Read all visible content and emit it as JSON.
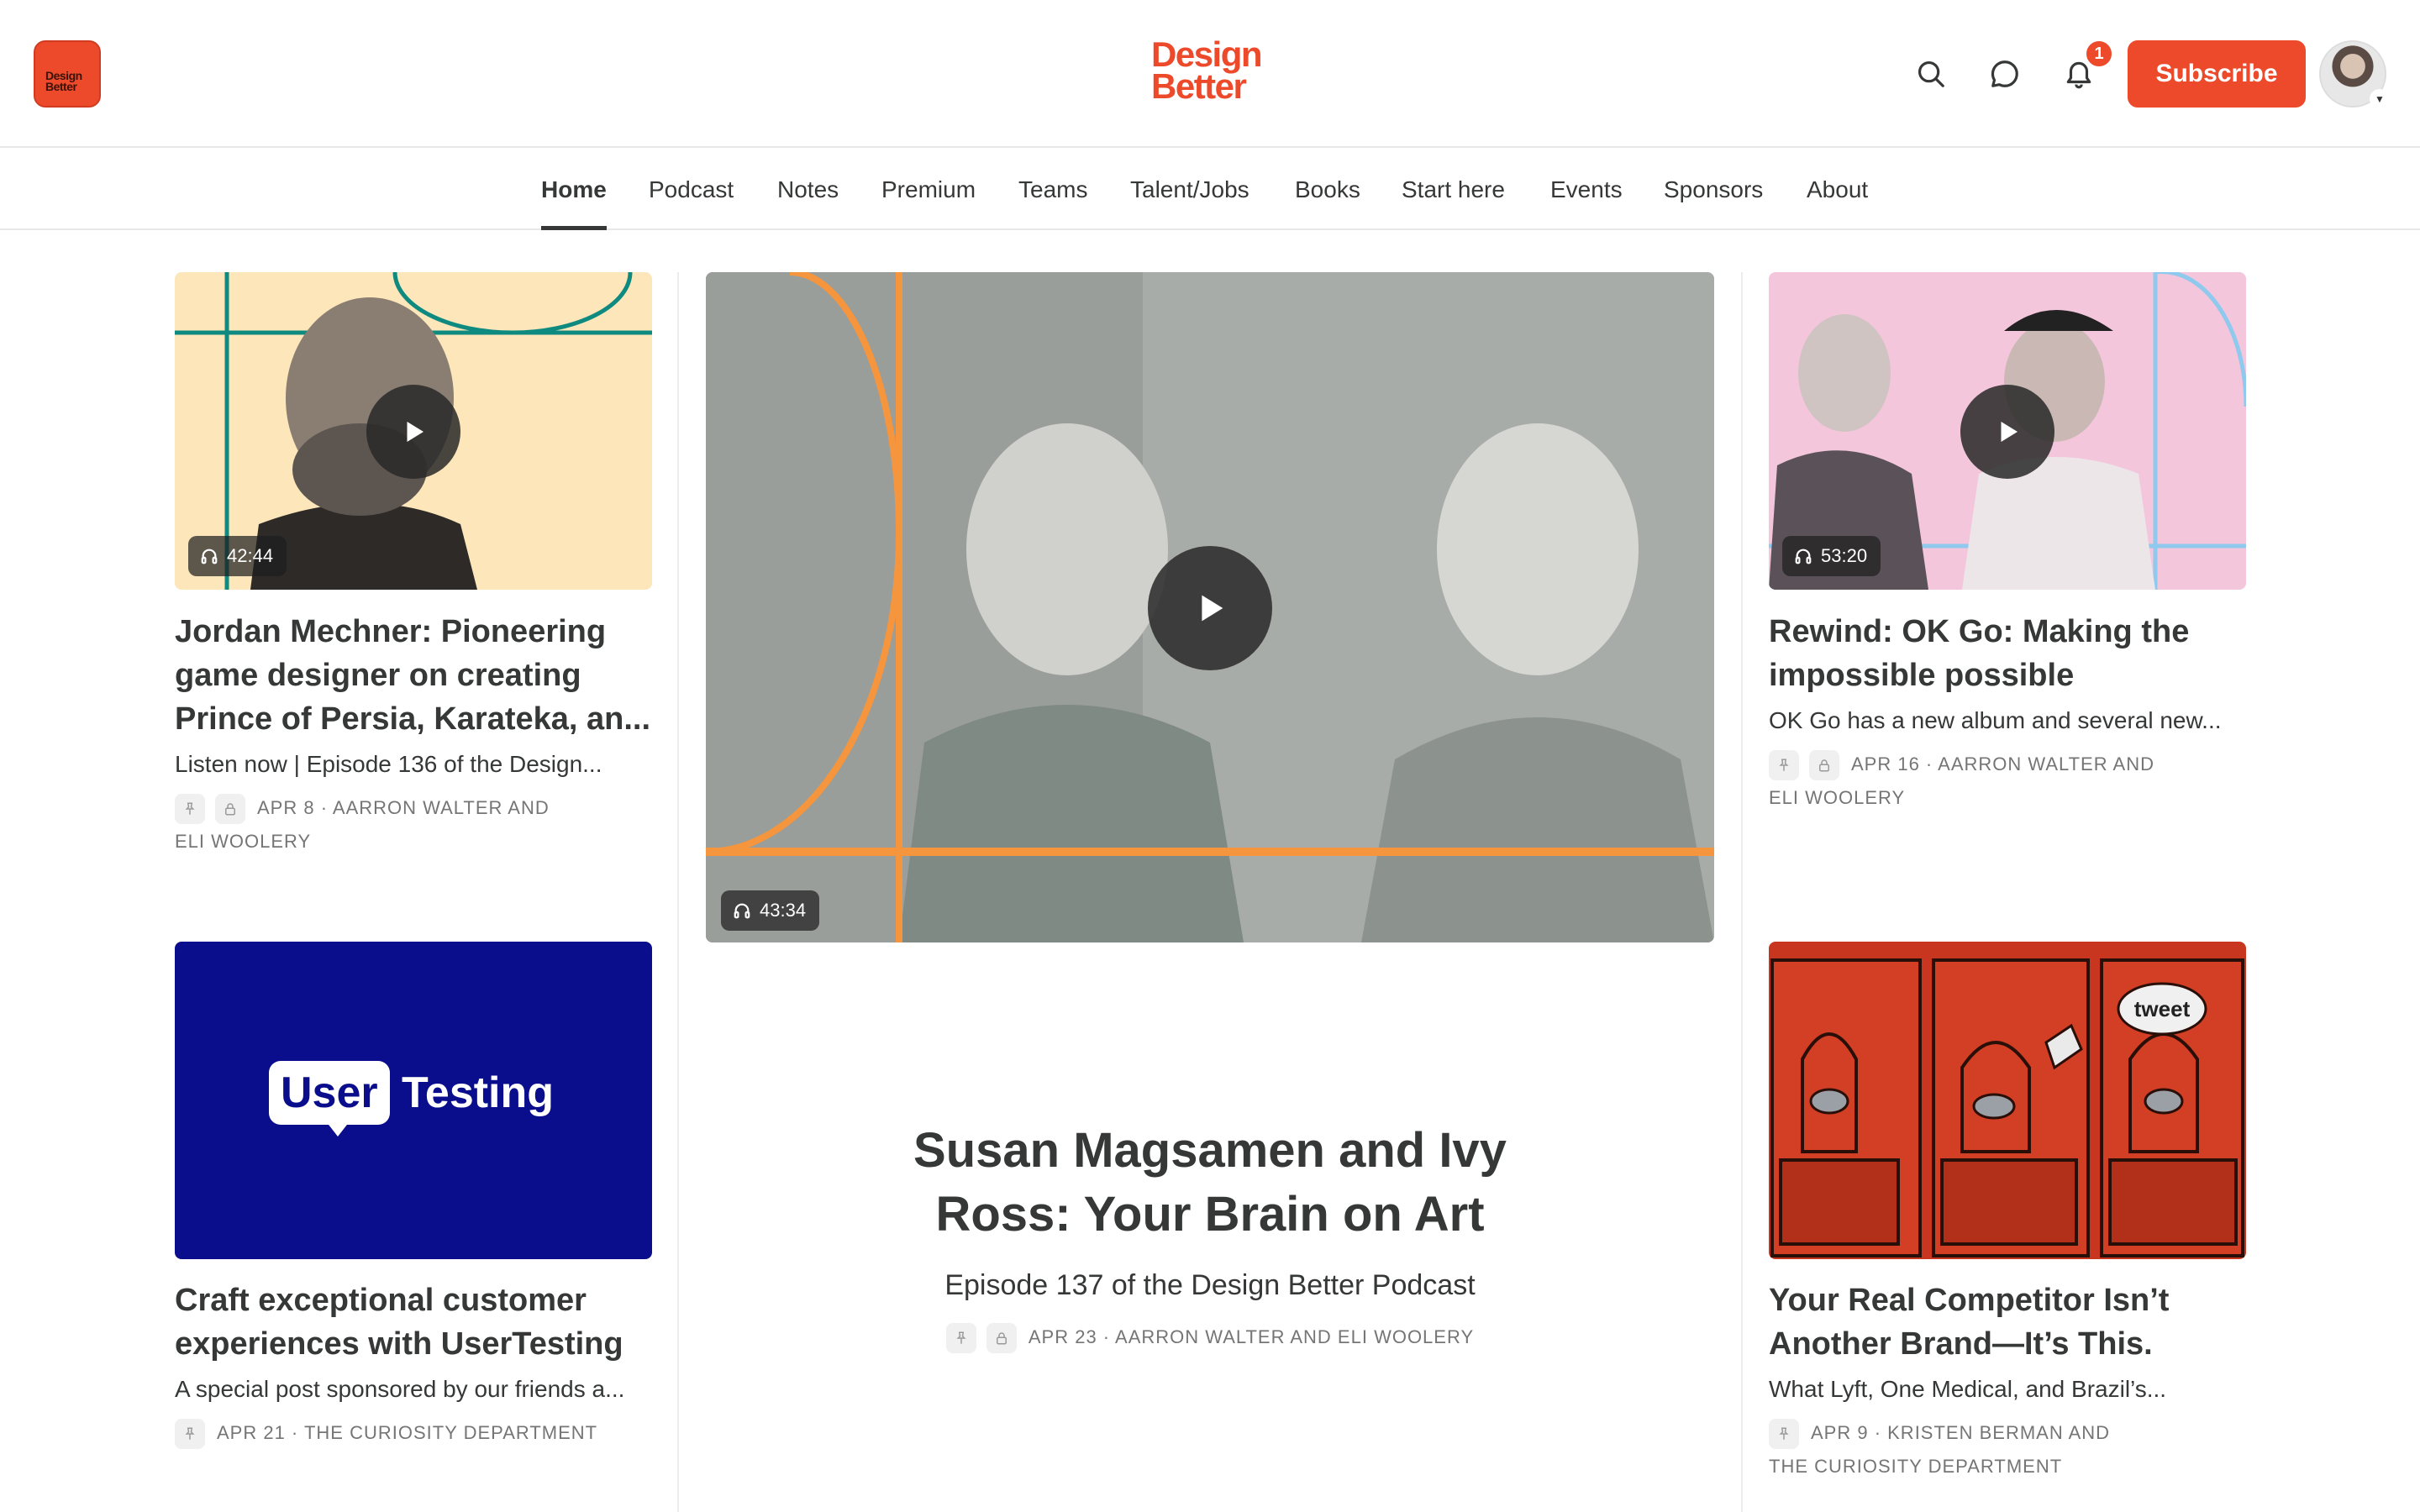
{
  "header": {
    "site_icon_text": "Design Better",
    "logo_line1": "Design",
    "logo_line2": "Better",
    "notification_count": "1",
    "subscribe_label": "Subscribe"
  },
  "nav": {
    "items": [
      {
        "label": "Home",
        "active": true
      },
      {
        "label": "Podcast"
      },
      {
        "label": "Notes"
      },
      {
        "label": "Premium"
      },
      {
        "label": "Teams"
      },
      {
        "label": "Talent/Jobs"
      },
      {
        "label": "Books"
      },
      {
        "label": "Start here"
      },
      {
        "label": "Events"
      },
      {
        "label": "Sponsors"
      },
      {
        "label": "About"
      }
    ]
  },
  "posts": {
    "left_top": {
      "duration": "42:44",
      "title": "Jordan Mechner: Pioneering game designer on creating Prince of Persia, Karateka, an...",
      "subtitle": "Listen now | Episode 136 of the Design...",
      "meta_line1": "APR 8 · AARRON WALTER AND",
      "meta_line2": "ELI WOOLERY"
    },
    "left_bottom": {
      "sponsor_brand_a": "User",
      "sponsor_brand_b": "Testing",
      "title": "Craft exceptional customer experiences with UserTesting",
      "subtitle": "A special post sponsored by our friends a...",
      "meta_line1": "APR 21 · THE CURIOSITY DEPARTMENT"
    },
    "center": {
      "duration": "43:34",
      "title": "Susan Magsamen and Ivy Ross: Your Brain on Art",
      "subtitle": "Episode 137 of the Design Better Podcast",
      "meta_line1": "APR 23 · AARRON WALTER AND ELI WOOLERY"
    },
    "right_top": {
      "duration": "53:20",
      "title": "Rewind: OK Go: Making the impossible possible",
      "subtitle": "OK Go has a new album and several new...",
      "meta_line1": "APR 16 · AARRON WALTER AND",
      "meta_line2": "ELI WOOLERY"
    },
    "right_bottom": {
      "bubble_text": "tweet",
      "title": "Your Real Competitor Isn’t Another Brand—It’s This.",
      "subtitle": "What Lyft, One Medical, and Brazil’s...",
      "meta_line1": "APR 9 · KRISTEN BERMAN AND",
      "meta_line2": "THE CURIOSITY DEPARTMENT"
    }
  },
  "colors": {
    "accent": "#ed4a2b",
    "text": "#363737",
    "meta": "#757575",
    "sponsor_bg": "#0a0e8c"
  }
}
